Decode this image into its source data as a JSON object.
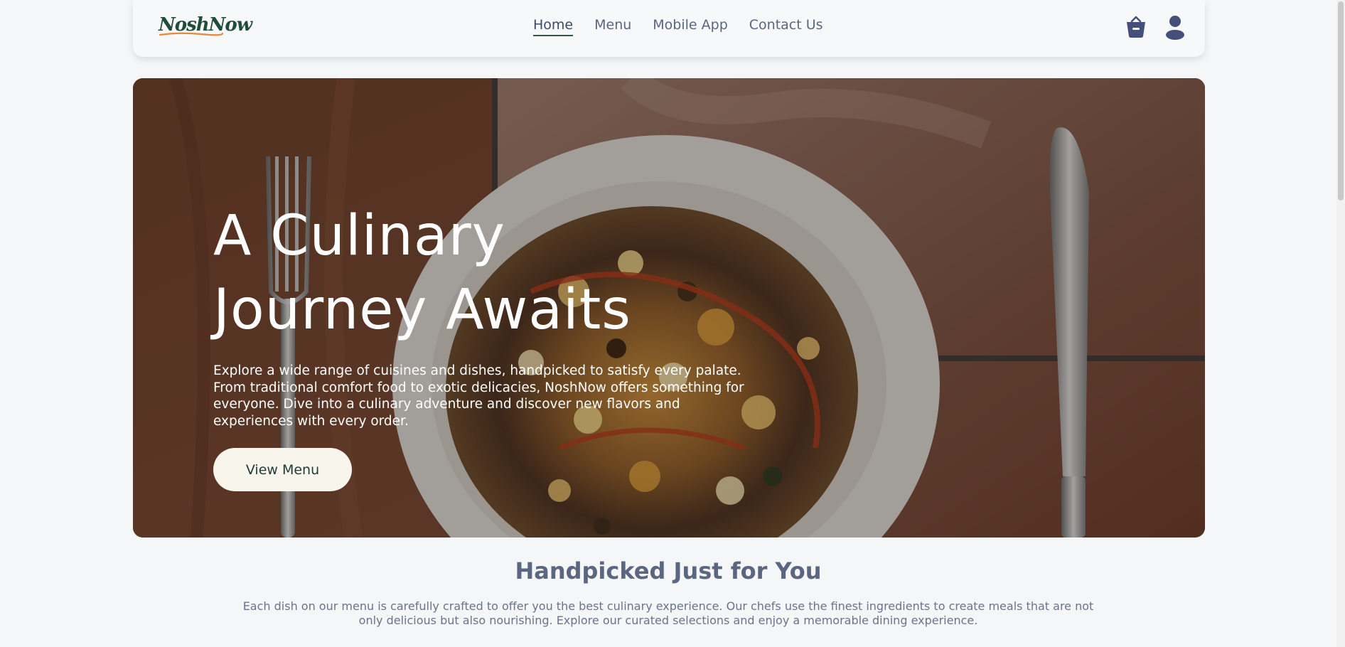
{
  "brand": {
    "name": "NoshNow",
    "primary_color": "#1f4d3a",
    "accent_color": "#e8883a"
  },
  "nav": {
    "items": [
      {
        "label": "Home",
        "active": true
      },
      {
        "label": "Menu",
        "active": false
      },
      {
        "label": "Mobile App",
        "active": false
      },
      {
        "label": "Contact Us",
        "active": false
      }
    ],
    "icons": [
      "basket-icon",
      "user-icon"
    ]
  },
  "hero": {
    "title_line1": "A Culinary",
    "title_line2": "Journey Awaits",
    "description": "Explore a wide range of cuisines and dishes, handpicked to satisfy every palate. From traditional comfort food to exotic delicacies, NoshNow offers something for everyone. Dive into a culinary adventure and discover new flavors and experiences with every order.",
    "button_label": "View Menu"
  },
  "featured": {
    "title": "Handpicked Just for You",
    "description": "Each dish on our menu is carefully crafted to offer you the best culinary experience. Our chefs use the finest ingredients to create meals that are not only delicious but also nourishing. Explore our curated selections and enjoy a memorable dining experience."
  }
}
